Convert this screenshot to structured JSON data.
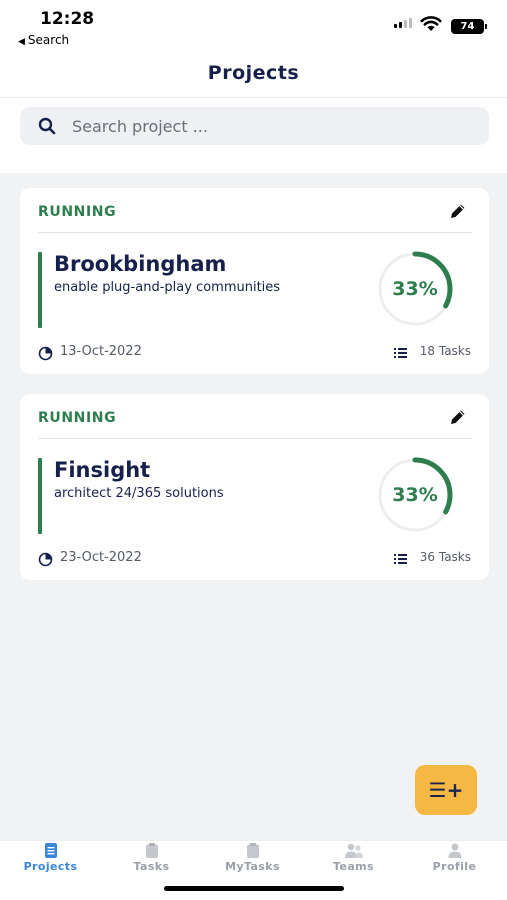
{
  "status_bar": {
    "time": "12:28",
    "back_label": "Search",
    "battery": "74"
  },
  "header": {
    "title": "Projects"
  },
  "search": {
    "placeholder": "Search project ..."
  },
  "projects": [
    {
      "status": "RUNNING",
      "name": "Brookbingham",
      "description": "enable plug-and-play communities",
      "progress_label": "33%",
      "progress": 0.33,
      "date": "13-Oct-2022",
      "tasks": "18 Tasks"
    },
    {
      "status": "RUNNING",
      "name": "Finsight",
      "description": "architect 24/365 solutions",
      "progress_label": "33%",
      "progress": 0.33,
      "date": "23-Oct-2022",
      "tasks": "36 Tasks"
    }
  ],
  "fab": {
    "label": "☰+"
  },
  "tabs": [
    {
      "label": "Projects",
      "active": true
    },
    {
      "label": "Tasks",
      "active": false
    },
    {
      "label": "MyTasks",
      "active": false
    },
    {
      "label": "Teams",
      "active": false
    },
    {
      "label": "Profile",
      "active": false
    }
  ],
  "colors": {
    "accent_green": "#2e7d4f",
    "navy": "#16204a",
    "active_tab": "#3a86d8",
    "fab": "#f5b843"
  }
}
